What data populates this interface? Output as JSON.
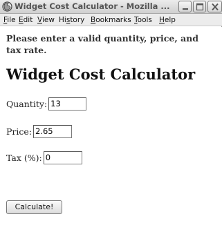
{
  "window": {
    "title": "Widget Cost Calculator - Mozilla ..."
  },
  "menu": {
    "file": {
      "mnemonic": "F",
      "rest": "ile"
    },
    "edit": {
      "mnemonic": "E",
      "rest": "dit"
    },
    "view": {
      "mnemonic": "V",
      "rest": "iew"
    },
    "history": {
      "pre": "Hi",
      "mnemonic": "s",
      "rest": "tory"
    },
    "bookmarks": {
      "mnemonic": "B",
      "rest": "ookmarks"
    },
    "tools": {
      "mnemonic": "T",
      "rest": "ools"
    },
    "help": {
      "mnemonic": "H",
      "rest": "elp"
    }
  },
  "page": {
    "error_message": "Please enter a valid quantity, price, and tax rate.",
    "heading": "Widget Cost Calculator",
    "quantity": {
      "label": "Quantity:",
      "value": "13"
    },
    "price": {
      "label": "Price:",
      "value": "2.65"
    },
    "tax": {
      "label": "Tax (%):",
      "value": "0"
    },
    "calculate_label": "Calculate!"
  },
  "icons": {
    "app": "firefox-icon",
    "minimize": "minimize-icon",
    "maximize": "maximize-icon",
    "close": "close-icon"
  },
  "colors": {
    "titlebar_text": "#555555",
    "background": "#ffffff"
  }
}
